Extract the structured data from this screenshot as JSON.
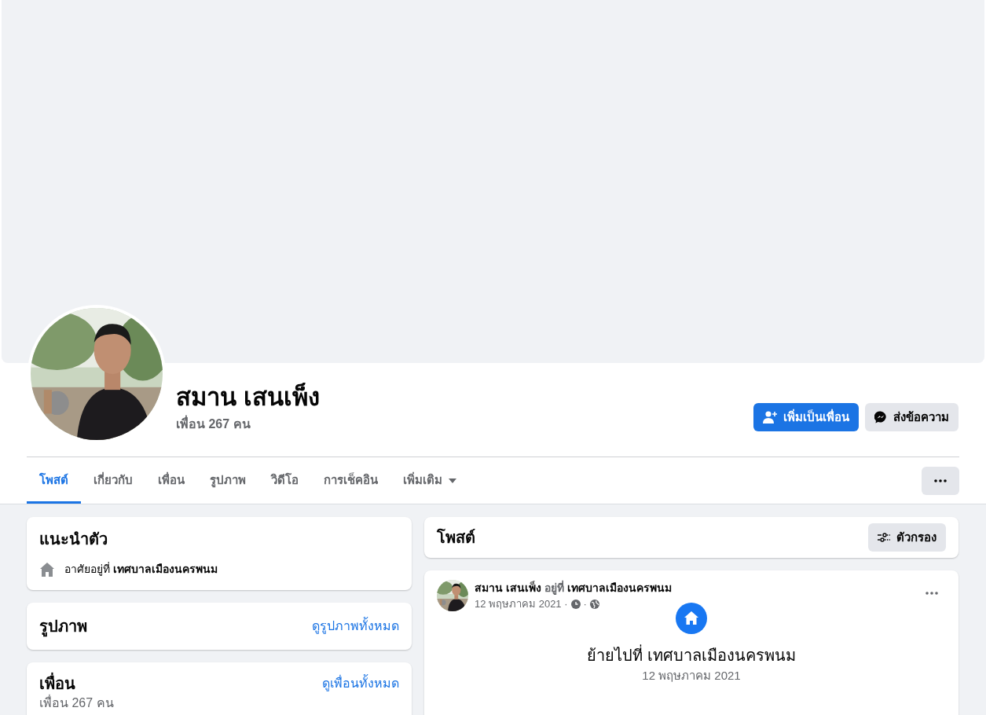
{
  "profile": {
    "name": "สมาน เสนเพ็ง",
    "friends_count": "เพื่อน 267 คน"
  },
  "actions": [
    {
      "label": "เพิ่มเป็นเพื่อน",
      "kind": "primary"
    },
    {
      "label": "ส่งข้อความ",
      "kind": "secondary"
    }
  ],
  "tabs": [
    {
      "label": "โพสต์",
      "selected": true,
      "kind": "plain"
    },
    {
      "label": "เกี่ยวกับ",
      "selected": false,
      "kind": "plain"
    },
    {
      "label": "เพื่อน",
      "selected": false,
      "kind": "plain"
    },
    {
      "label": "รูปภาพ",
      "selected": false,
      "kind": "plain"
    },
    {
      "label": "วิดีโอ",
      "selected": false,
      "kind": "plain"
    },
    {
      "label": "การเช็คอิน",
      "selected": false,
      "kind": "plain"
    },
    {
      "label": "เพิ่มเติม",
      "selected": false,
      "kind": "dropdown"
    }
  ],
  "intro": {
    "title": "แนะนำตัว",
    "lives_in": "อาศัยอยู่ที่ **เทศบาลเมืองนครพนม**"
  },
  "photos": {
    "title": "รูปภาพ",
    "link": "ดูรูปภาพทั้งหมด"
  },
  "friends": {
    "title": "เพื่อน",
    "link": "ดูเพื่อนทั้งหมด",
    "count": "เพื่อน 267 คน"
  },
  "posts_header": {
    "title": "โพสต์",
    "filter": "ตัวกรอง"
  },
  "post": {
    "author_line": "**สมาน เสนเพ็ง** อยู่ที่ **เทศบาลเมืองนครพนม**",
    "date": "12 พฤษภาคม 2021 ·",
    "separator": "·",
    "event_text": "ย้ายไปที่ เทศบาลเมืองนครพนม",
    "event_date": "12 พฤษภาคม 2021"
  }
}
